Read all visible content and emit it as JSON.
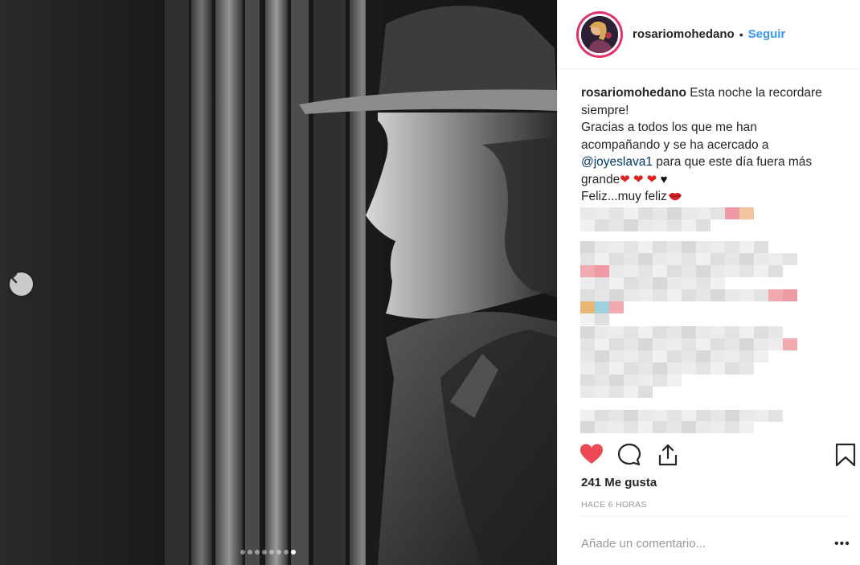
{
  "post": {
    "photo_alt": "",
    "carousel": {
      "count": 8,
      "active_index": 7
    }
  },
  "header": {
    "username": "rosariomohedano",
    "separator": "•",
    "follow_label": "Seguir"
  },
  "caption": {
    "username": "rosariomohedano",
    "line1": "Esta noche la recordare siempre!",
    "line2a": "Gracias a todos los que me han acompañando y se ha acercado a",
    "mention": "@joyeslava1",
    "line2b": "para que este día fuera más grande",
    "hearts": "❤ ❤ ❤",
    "black_heart": "♥",
    "line3": "Feliz...muy feliz",
    "lips_icon": "lips-icon"
  },
  "actions": {
    "like_icon": "heart-filled-icon",
    "comment_icon": "comment-icon",
    "share_icon": "share-icon",
    "save_icon": "bookmark-icon",
    "like_color": "#ed4956"
  },
  "likes_text": "241 Me gusta",
  "time_text": "HACE 6 HORAS",
  "comment_placeholder": "Añade un comentario...",
  "more_label": "•••",
  "colors": {
    "follow": "#3897f0",
    "mention": "#003569",
    "muted": "#999999",
    "avatar_ring": "#e1306c"
  }
}
